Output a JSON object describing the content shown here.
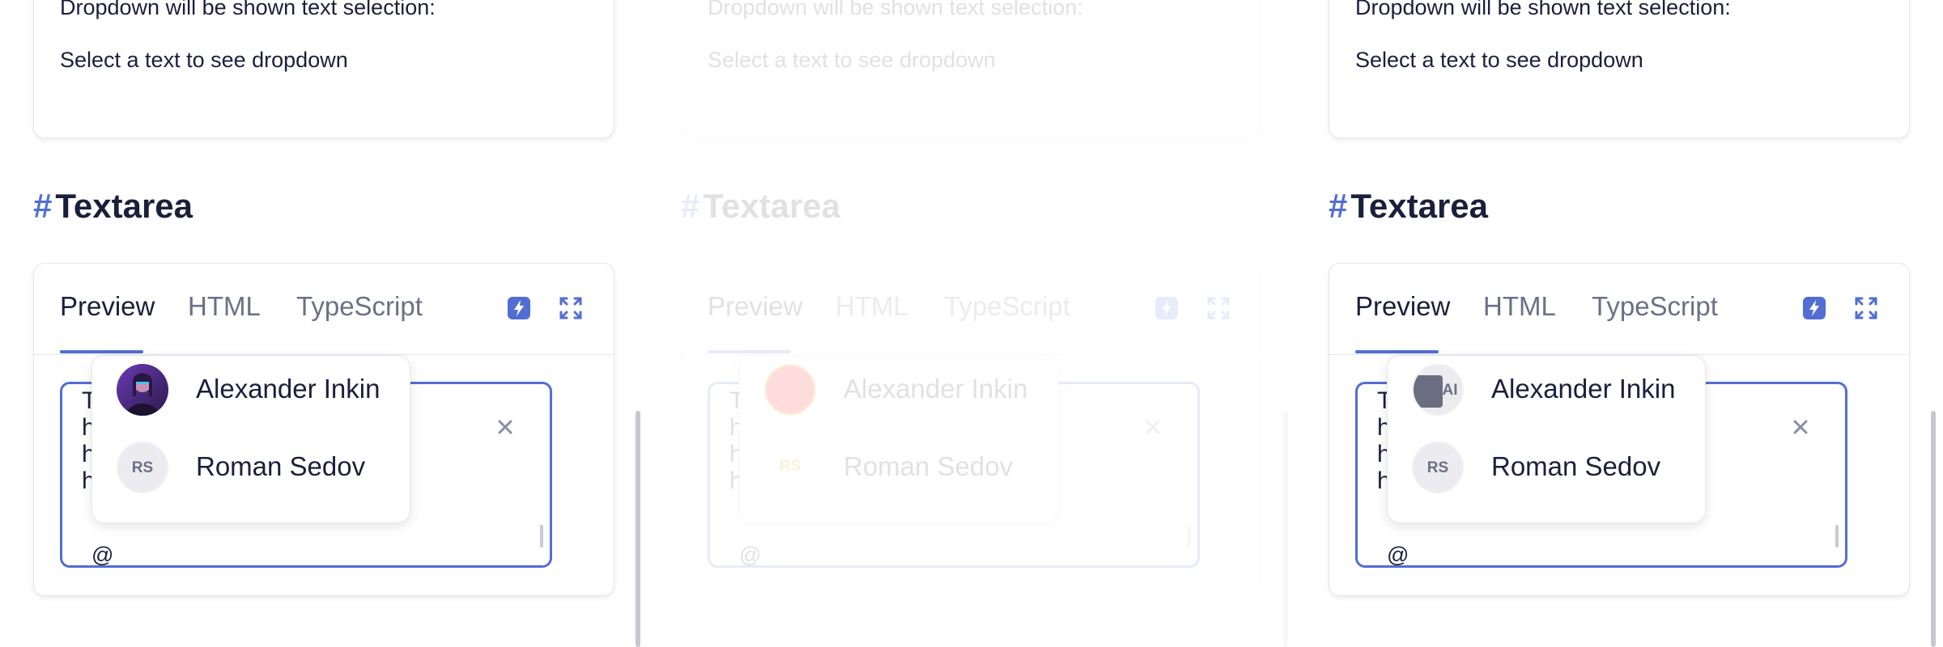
{
  "panels": [
    {
      "top_card": {
        "line1": "Dropdown will be shown text selection:",
        "line2": "Select a text to see dropdown"
      },
      "heading": {
        "hash": "#",
        "title": "Textarea"
      },
      "tabs": [
        {
          "label": "Preview",
          "active": true
        },
        {
          "label": "HTML",
          "active": false
        },
        {
          "label": "TypeScript",
          "active": false
        }
      ],
      "tools": [
        {
          "icon": "lightning-icon"
        },
        {
          "icon": "expand-icon"
        }
      ],
      "textarea": {
        "visible_text": "T\nh\nh\nh",
        "at_text": "@",
        "clear_icon": "close-icon"
      },
      "dropdown": {
        "items": [
          {
            "name": "Alexander Inkin",
            "avatar": "photo",
            "initials": ""
          },
          {
            "name": "Roman Sedov",
            "avatar": "initials",
            "initials": "RS"
          }
        ]
      }
    },
    {
      "top_card": {
        "line1": "Dropdown will be shown text selection:",
        "line2": "Select a text to see dropdown"
      },
      "heading": {
        "hash": "#",
        "title": "Textarea"
      },
      "tabs": [
        {
          "label": "Preview",
          "active": true
        },
        {
          "label": "HTML",
          "active": false
        },
        {
          "label": "TypeScript",
          "active": false
        }
      ],
      "tools": [
        {
          "icon": "lightning-icon"
        },
        {
          "icon": "expand-icon"
        }
      ],
      "textarea": {
        "visible_text": "T\nh\nh\nh",
        "at_text": "@",
        "clear_icon": "close-icon"
      },
      "dropdown": {
        "items": [
          {
            "name": "Alexander Inkin",
            "avatar": "red-circle",
            "initials": ""
          },
          {
            "name": "Roman Sedov",
            "avatar": "initials",
            "initials": "RS"
          }
        ]
      }
    },
    {
      "top_card": {
        "line1": "Dropdown will be shown text selection:",
        "line2": "Select a text to see dropdown"
      },
      "heading": {
        "hash": "#",
        "title": "Textarea"
      },
      "tabs": [
        {
          "label": "Preview",
          "active": true
        },
        {
          "label": "HTML",
          "active": false
        },
        {
          "label": "TypeScript",
          "active": false
        }
      ],
      "tools": [
        {
          "icon": "lightning-icon"
        },
        {
          "icon": "expand-icon"
        }
      ],
      "textarea": {
        "visible_text": "T\nh\nh\nh",
        "at_text": "@",
        "clear_icon": "close-icon"
      },
      "dropdown": {
        "items": [
          {
            "name": "Alexander Inkin",
            "avatar": "initials",
            "initials": "AI"
          },
          {
            "name": "Roman Sedov",
            "avatar": "initials",
            "initials": "RS"
          }
        ]
      }
    }
  ],
  "colors": {
    "accent": "#526ed3",
    "text": "#1b1f3b",
    "muted": "#6b7184",
    "border": "#e4e6ee",
    "avatar_red": "#ff0000"
  }
}
